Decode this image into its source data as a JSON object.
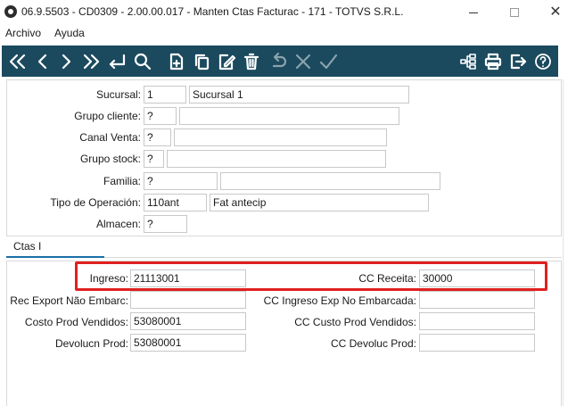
{
  "window": {
    "title": "06.9.5503 - CD0309 - 2.00.00.017 - Manten Ctas Facturac - 171 - TOTVS S.R.L."
  },
  "menu": {
    "items": [
      "Archivo",
      "Ayuda"
    ]
  },
  "toolbar": {
    "color": "#1b4a5e",
    "left_buttons": [
      "first-record-icon",
      "previous-record-icon",
      "next-record-icon",
      "last-record-icon",
      "goto-icon",
      "search-icon",
      "new-record-icon",
      "copy-icon",
      "edit-icon",
      "delete-icon",
      "undo-icon",
      "cancel-icon",
      "save-icon"
    ],
    "right_buttons": [
      "hierarchy-icon",
      "print-icon",
      "exit-icon",
      "help-icon"
    ]
  },
  "form": {
    "sucursal": {
      "label": "Sucursal:",
      "code": "1",
      "desc": "Sucursal 1"
    },
    "grupo_cliente": {
      "label": "Grupo cliente:",
      "code": "?",
      "desc": ""
    },
    "canal_venta": {
      "label": "Canal Venta:",
      "code": "?",
      "desc": ""
    },
    "grupo_stock": {
      "label": "Grupo stock:",
      "code": "?",
      "desc": ""
    },
    "familia": {
      "label": "Familia:",
      "code": "?",
      "desc": ""
    },
    "tipo_operacion": {
      "label": "Tipo de Operación:",
      "code": "110ant",
      "desc": "Fat antecip"
    },
    "almacen": {
      "label": "Almacen:",
      "code": "?"
    }
  },
  "tabs": [
    {
      "label": "Ctas I",
      "active": true
    }
  ],
  "tab_fields": {
    "ingreso": {
      "label": "Ingreso:",
      "value": "21113001"
    },
    "cc_receita": {
      "label": "CC Receita:",
      "value": "30000"
    },
    "rec_export": {
      "label": "Rec Export Não Embarc:",
      "value": ""
    },
    "cc_ingreso_exp": {
      "label": "CC Ingreso Exp No Embarcada:",
      "value": ""
    },
    "costo_prod": {
      "label": "Costo Prod Vendidos:",
      "value": "53080001"
    },
    "cc_custo_prod": {
      "label": "CC Custo Prod Vendidos:",
      "value": ""
    },
    "devolucn_prod": {
      "label": "Devolucn Prod:",
      "value": "53080001"
    },
    "cc_devoluc_prod": {
      "label": "CC Devoluc Prod:",
      "value": ""
    }
  },
  "highlight_color": "#e02020"
}
